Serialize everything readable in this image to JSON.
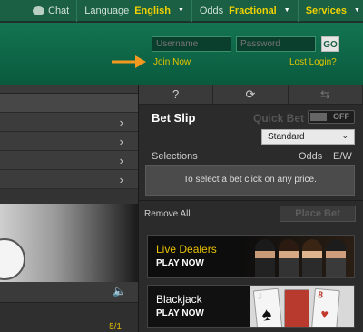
{
  "topbar": {
    "chat_label": "Chat",
    "language_label": "Language",
    "language_value": "English",
    "odds_label": "Odds",
    "odds_value": "Fractional",
    "services_label": "Services"
  },
  "header": {
    "username_placeholder": "Username",
    "password_placeholder": "Password",
    "go_label": "GO",
    "join_label": "Join Now",
    "lost_login_label": "Lost Login?"
  },
  "left": {
    "odds_value": "5/1"
  },
  "betslip": {
    "icons": [
      "help-icon",
      "refresh-icon",
      "swap-icon"
    ],
    "icon_glyphs": [
      "?",
      "⟳",
      "⇆"
    ],
    "title": "Bet Slip",
    "quickbet_label": "Quick Bet",
    "toggle_label": "OFF",
    "mode_value": "Standard",
    "selections_label": "Selections",
    "odds_label": "Odds",
    "ew_label": "E/W",
    "empty_message": "To select a bet click on any price.",
    "remove_all_label": "Remove All",
    "place_bet_label": "Place Bet"
  },
  "promos": [
    {
      "title": "Live Dealers",
      "cta": "PLAY NOW"
    },
    {
      "title": "Blackjack",
      "cta": "PLAY NOW"
    }
  ],
  "colors": {
    "brand_green": "#137452",
    "accent_yellow": "#e5c400"
  }
}
